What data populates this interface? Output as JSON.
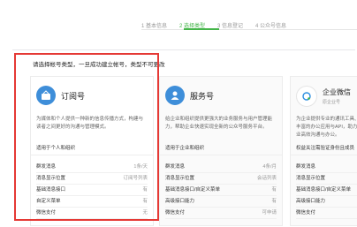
{
  "steps": [
    {
      "label": "1 基本信息",
      "active": false
    },
    {
      "label": "2 选择类型",
      "active": true
    },
    {
      "label": "3 信息登记",
      "active": false
    },
    {
      "label": "4 公众号信息",
      "active": false
    }
  ],
  "instruction": "请选择帐号类型，一旦成功建立帐号，类型不可更改",
  "cards": {
    "dingyue": {
      "title": "订阅号",
      "desc": "为媒体和个人提供一种新的信息传播方式，构建与读者之间更好的沟通与管理模式。",
      "audience": "适用于个人和组织",
      "features": [
        {
          "name": "群发消息",
          "value": "1条/天"
        },
        {
          "name": "消息显示位置",
          "value": "订阅号列表"
        },
        {
          "name": "基础消息接口",
          "value": "有"
        },
        {
          "name": "自定义菜单",
          "value": "有"
        },
        {
          "name": "微信支付",
          "value": "无"
        }
      ]
    },
    "fuwu": {
      "title": "服务号",
      "desc": "给企业和组织提供更强大的业务服务与用户管理能力，帮助企业快速实现全新的公众号服务平台。",
      "audience": "适用于企业和组织",
      "features": [
        {
          "name": "群发消息",
          "value": "4条/月"
        },
        {
          "name": "消息显示位置",
          "value": "会话列表"
        },
        {
          "name": "基础消息接口/自定义菜单",
          "value": "有"
        },
        {
          "name": "高级接口能力",
          "value": "有"
        },
        {
          "name": "微信支付",
          "value": "可申请"
        }
      ]
    },
    "qiye": {
      "title": "企业微信",
      "subtitle": "原企业号",
      "desc": "为企业提供专业的通讯工具、丰富的办公应用与API，助力企业高效沟通与办公。",
      "audience": "权益关注需验证身份且成员",
      "features": [
        {
          "name": "群发消息",
          "value": ""
        },
        {
          "name": "消息显示位置",
          "value": ""
        },
        {
          "name": "基础消息接口/自定义菜单",
          "value": ""
        },
        {
          "name": "高级接口能力",
          "value": ""
        },
        {
          "name": "微信支付",
          "value": ""
        }
      ]
    }
  },
  "colors": {
    "accent": "#44b549",
    "highlight": "#e53935",
    "logo": "#3e8ed9"
  }
}
